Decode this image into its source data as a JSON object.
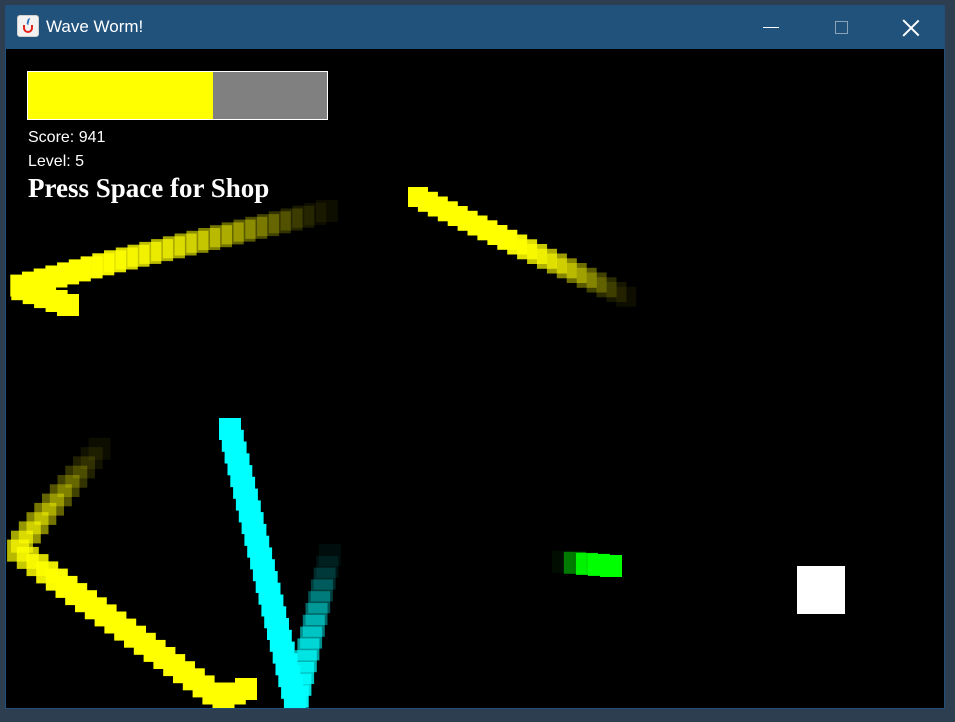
{
  "window": {
    "title": "Wave Worm!",
    "icon": "java-cup-icon"
  },
  "hud": {
    "health_fraction": 0.62,
    "health_color": "#ffff00",
    "health_empty_color": "#808080",
    "score_text": "Score: 941",
    "level_text": "Level: 5",
    "shop_hint": "Press Space for Shop"
  },
  "entities": {
    "colors": {
      "enemy_worm": "#ffff00",
      "player_worm": "#00ffff",
      "green_worm": "#00ff00",
      "pickup": "#ffffff"
    }
  }
}
